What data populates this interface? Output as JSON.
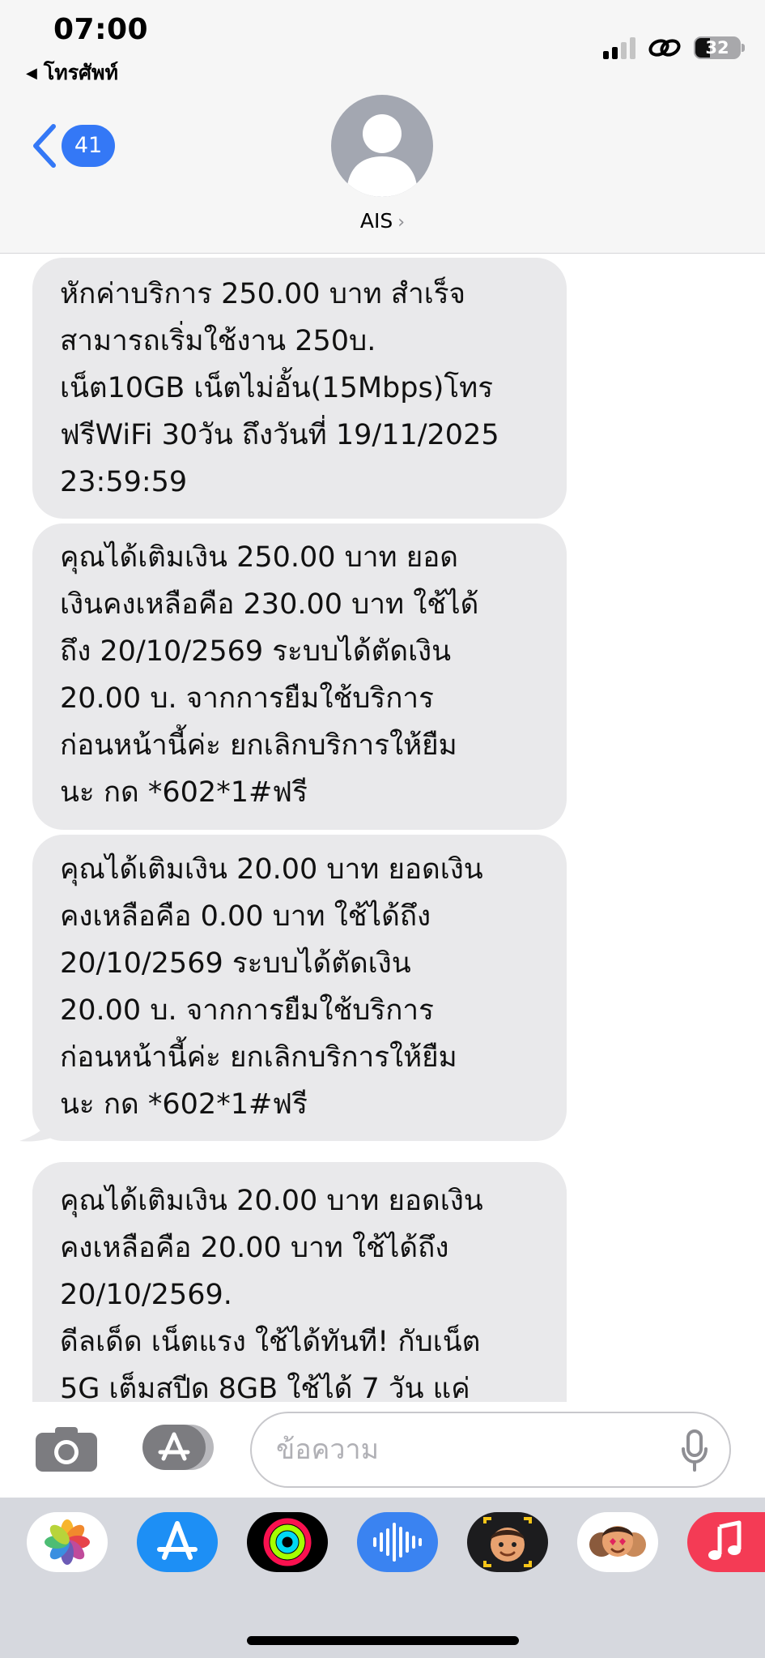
{
  "status_bar": {
    "time": "07:00",
    "back_app": "โทรศัพท์",
    "battery": "32"
  },
  "nav": {
    "unread_count": "41",
    "contact_name": "AIS"
  },
  "messages": [
    {
      "text": "หักค่าบริการ 250.00 บาท สำเร็จ\nสามารถเริ่มใช้งาน 250บ.\nเน็ต10GB เน็ตไม่อั้น(15Mbps)โทร\nฟรีWiFi 30วัน ถึงวันที่ 19/11/2025\n23:59:59"
    },
    {
      "text": "คุณได้เติมเงิน 250.00 บาท ยอด\nเงินคงเหลือคือ 230.00 บาท ใช้ได้\nถึง 20/10/2569 ระบบได้ตัดเงิน\n20.00 บ. จากการยืมใช้บริการ\nก่อนหน้านี้ค่ะ ยกเลิกบริการให้ยืม\nนะ กด *602*1#ฟรี"
    },
    {
      "text": "คุณได้เติมเงิน 20.00 บาท ยอดเงิน\nคงเหลือคือ 0.00 บาท ใช้ได้ถึง\n20/10/2569 ระบบได้ตัดเงิน\n20.00 บ. จากการยืมใช้บริการ\nก่อนหน้านี้ค่ะ ยกเลิกบริการให้ยืม\nนะ กด *602*1#ฟรี"
    },
    {
      "text": "คุณได้เติมเงิน 20.00 บาท ยอดเงิน\nคงเหลือคือ 20.00 บาท ใช้ได้ถึง\n20/10/2569.\nดีลเด็ด เน็ตแรง ใช้ได้ทันที! กับเน็ต\n5G เต็มสปีด 8GB ใช้ได้ 7 วัน แค่"
    }
  ],
  "composer": {
    "placeholder": "ข้อความ"
  },
  "app_drawer": {
    "apps": [
      "photos-icon",
      "app-store-icon",
      "fitness-icon",
      "audio-message-icon",
      "memoji-icon",
      "memoji-stickers-icon",
      "music-icon"
    ]
  },
  "colors": {
    "bubble_bg": "#e9e9eb",
    "accent": "#3478f6",
    "header_bg": "#f6f6f6",
    "drawer_bg": "#d6d8de"
  }
}
